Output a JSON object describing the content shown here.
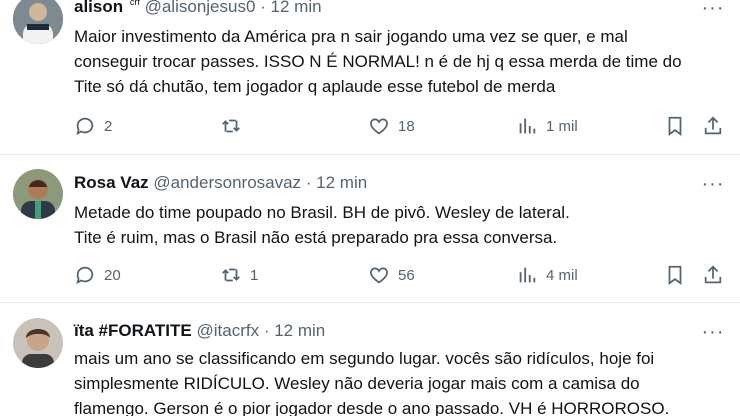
{
  "tweets": [
    {
      "name": "alison",
      "badge": "crf",
      "handle": "@alisonjesus0",
      "time": "12 min",
      "lines": [
        "Maior investimento da América  pra n sair jogando uma vez se quer, e mal",
        "conseguir trocar passes. ISSO N É NORMAL! n é de hj q essa merda de time do",
        "Tite só dá chutão, tem jogador q aplaude esse futebol de merda"
      ],
      "replies": "2",
      "retweets": "",
      "likes": "18",
      "views": "1 mil"
    },
    {
      "name": "Rosa Vaz",
      "badge": "",
      "handle": "@andersonrosavaz",
      "time": "12 min",
      "lines": [
        "Metade do time poupado no Brasil. BH de pivô. Wesley de lateral.",
        "Tite é ruim, mas o Brasil não está preparado pra essa conversa."
      ],
      "replies": "20",
      "retweets": "1",
      "likes": "56",
      "views": "4 mil"
    },
    {
      "name": "ïta #FORATITE",
      "badge": "",
      "handle": "@itacrfx",
      "time": "12 min",
      "lines": [
        "mais um ano se classificando em segundo lugar. vocês são ridículos, hoje foi",
        "simplesmente RIDÍCULO. Wesley não deveria jogar mais com a camisa do",
        "flamengo. Gerson é o pior jogador desde o ano passado. VH é HORROROSO."
      ],
      "replies": "",
      "retweets": "",
      "likes": "",
      "views": ""
    }
  ],
  "separator": " · ",
  "more_glyph": "···",
  "colors": {
    "text": "#0f1419",
    "muted": "#536471",
    "divider": "#e6e9ec"
  }
}
